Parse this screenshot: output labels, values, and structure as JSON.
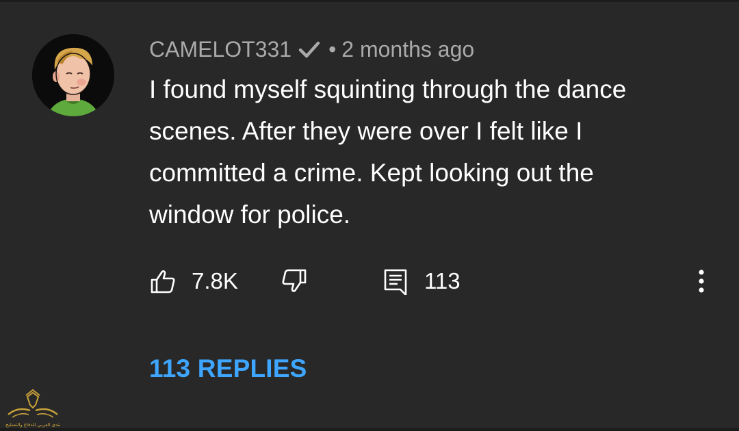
{
  "comment": {
    "author": "CAMELOT331",
    "verified_icon": "check-icon",
    "separator": "•",
    "timestamp": "2 months ago",
    "text_lines": [
      "I found myself squinting through the dance",
      "scenes. After they were over I felt like I",
      "committed a crime. Kept looking out the",
      "window for police."
    ],
    "likes": "7.8K",
    "reply_count": "113",
    "replies_label": "113 REPLIES"
  },
  "icons": {
    "like": "thumbs-up-icon",
    "dislike": "thumbs-down-icon",
    "reply": "comment-icon",
    "more": "more-vert-icon"
  },
  "watermark": {
    "text": "المنتدى العربي للدفاع والتسليح"
  },
  "colors": {
    "background": "#282828",
    "meta_text": "#aaaaaa",
    "primary_text": "#ffffff",
    "link_blue": "#3ea6ff"
  }
}
